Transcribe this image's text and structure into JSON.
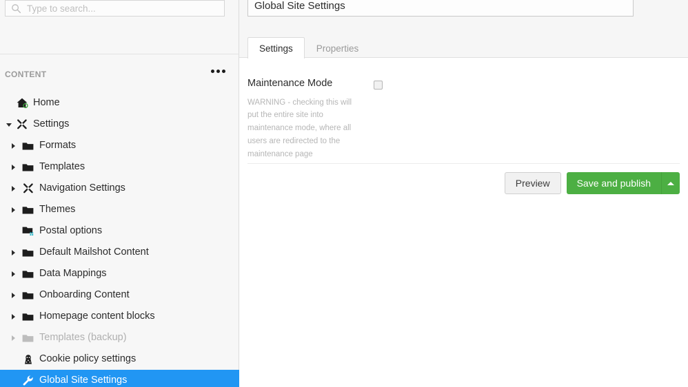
{
  "sidebar": {
    "search": {
      "placeholder": "Type to search...",
      "value": "",
      "icon": "search-icon"
    },
    "section_title": "CONTENT",
    "overflow_menu_icon": "ellipsis-icon",
    "tree": [
      {
        "label": "Home",
        "icon": "home-icon",
        "level": 0,
        "caret": "none",
        "state": "normal"
      },
      {
        "label": "Settings",
        "icon": "settings-icon",
        "level": 0,
        "caret": "expanded",
        "state": "normal"
      },
      {
        "label": "Formats",
        "icon": "folder-icon",
        "level": 1,
        "caret": "collapsed",
        "state": "normal"
      },
      {
        "label": "Templates",
        "icon": "folder-icon",
        "level": 1,
        "caret": "collapsed",
        "state": "normal"
      },
      {
        "label": "Navigation Settings",
        "icon": "settings-icon",
        "level": 1,
        "caret": "collapsed",
        "state": "normal"
      },
      {
        "label": "Themes",
        "icon": "folder-icon",
        "level": 1,
        "caret": "collapsed",
        "state": "normal"
      },
      {
        "label": "Postal options",
        "icon": "folder-dots-icon",
        "level": 1,
        "caret": "none",
        "state": "normal"
      },
      {
        "label": "Default Mailshot Content",
        "icon": "folder-icon",
        "level": 1,
        "caret": "collapsed",
        "state": "normal"
      },
      {
        "label": "Data Mappings",
        "icon": "folder-icon",
        "level": 1,
        "caret": "collapsed",
        "state": "normal"
      },
      {
        "label": "Onboarding Content",
        "icon": "folder-icon",
        "level": 1,
        "caret": "collapsed",
        "state": "normal"
      },
      {
        "label": "Homepage content blocks",
        "icon": "folder-icon",
        "level": 1,
        "caret": "collapsed",
        "state": "normal"
      },
      {
        "label": "Templates (backup)",
        "icon": "folder-icon",
        "level": 1,
        "caret": "collapsed",
        "state": "disabled"
      },
      {
        "label": "Cookie policy settings",
        "icon": "cookie-icon",
        "level": 1,
        "caret": "none",
        "state": "normal"
      },
      {
        "label": "Global Site Settings",
        "icon": "wrench-icon",
        "level": 1,
        "caret": "none",
        "state": "selected"
      }
    ]
  },
  "main": {
    "title_value": "Global Site Settings",
    "tabs": [
      {
        "label": "Settings",
        "active": true
      },
      {
        "label": "Properties",
        "active": false
      }
    ],
    "fields": [
      {
        "label": "Maintenance Mode",
        "description": "WARNING - checking this will put the entire site into maintenance mode, where all users are redirected to the maintenance page",
        "control": "checkbox",
        "checked": false
      }
    ],
    "actions": {
      "preview_label": "Preview",
      "save_label": "Save and publish",
      "save_caret_icon": "caret-up-icon"
    }
  },
  "colors": {
    "accent_blue": "#2196f3",
    "save_green": "#4caf43",
    "sidebar_bg": "#f7f7f7",
    "header_bg": "#f6f6f6",
    "muted_text": "#b6b6b6"
  }
}
